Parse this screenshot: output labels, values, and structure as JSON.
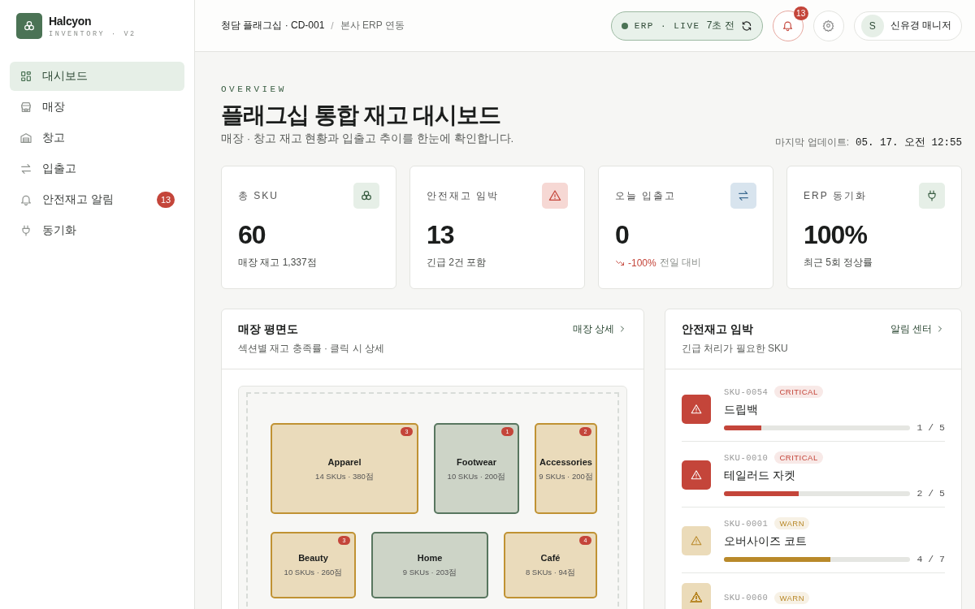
{
  "brand": {
    "name": "Halcyon",
    "tagline": "INVENTORY · V2"
  },
  "nav": [
    {
      "label": "대시보드",
      "selected": true
    },
    {
      "label": "매장",
      "selected": false
    },
    {
      "label": "창고",
      "selected": false
    },
    {
      "label": "입출고",
      "selected": false
    },
    {
      "label": "안전재고 알림",
      "selected": false,
      "badge": "13"
    },
    {
      "label": "동기화",
      "selected": false
    }
  ],
  "header": {
    "breadcrumb": [
      "청담 플래그십 · CD-001",
      "/",
      "본사 ERP 연동"
    ],
    "sync_label": "ERP · LIVE",
    "sync_age": "7초 전",
    "notifications": "13",
    "avatar": "S",
    "user": "신유경 매니저"
  },
  "page": {
    "eyebrow": "OVERVIEW",
    "title": "플래그십 통합 재고 대시보드",
    "subtitle": "매장 · 창고 재고 현황과 입출고 추이를 한눈에 확인합니다.",
    "updated_label": "마지막 업데이트:",
    "updated_value": "05. 17. 오전 12:55"
  },
  "stats": [
    {
      "kind": "sku",
      "label": "총 SKU",
      "value": "60",
      "note": "매장 재고 1,337점"
    },
    {
      "kind": "alert",
      "label": "안전재고 임박",
      "value": "13",
      "note": "긴급 2건 포함"
    },
    {
      "kind": "flow",
      "label": "오늘 입출고",
      "value": "0",
      "delta": "-100%",
      "note": "전일 대비"
    },
    {
      "kind": "sync",
      "label": "ERP 동기화",
      "value": "100%",
      "note": "최근 5회 정상률"
    }
  ],
  "floor_plan": {
    "title": "매장 평면도",
    "subtitle": "섹션별 재고 충족률 · 클릭 시 상세",
    "link": "매장 상세",
    "sections": [
      {
        "name": "Apparel",
        "detail": "14 SKUs · 380점",
        "color": "#c09233",
        "alerts": "3"
      },
      {
        "name": "Footwear",
        "detail": "10 SKUs · 200점",
        "color": "#58765f",
        "alerts": "1"
      },
      {
        "name": "Accessories",
        "detail": "9 SKUs · 200점",
        "color": "#c09233",
        "alerts": "2"
      },
      {
        "name": "Beauty",
        "detail": "10 SKUs · 260점",
        "color": "#c09233",
        "alerts": "3"
      },
      {
        "name": "Home",
        "detail": "9 SKUs · 203점",
        "color": "#58765f"
      },
      {
        "name": "Café",
        "detail": "8 SKUs · 94점",
        "color": "#c09233",
        "alerts": "4"
      }
    ]
  },
  "alerts": {
    "title": "안전재고 임박",
    "subtitle": "긴급 처리가 필요한 SKU",
    "link": "알림 센터",
    "items": [
      {
        "sku": "SKU-0054",
        "color": "#c4453a",
        "badge": "CRITICAL",
        "name": "드립백",
        "level": 0.2,
        "count": "1 / 5"
      },
      {
        "sku": "SKU-0010",
        "color": "#c4453a",
        "badge": "CRITICAL",
        "name": "테일러드 자켓",
        "level": 0.4,
        "count": "2 / 5"
      },
      {
        "sku": "SKU-0001",
        "color": "#b9892a",
        "badge": "WARN",
        "name": "오버사이즈 코트",
        "level": 0.571,
        "count": "4 / 7"
      },
      {
        "sku": "SKU-0060",
        "color": "#b9892a",
        "badge": "WARN"
      }
    ]
  }
}
